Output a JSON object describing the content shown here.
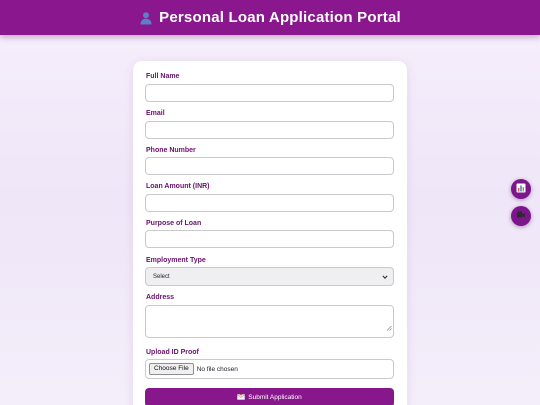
{
  "header": {
    "title": "Personal Loan Application Portal",
    "icon": "user-icon"
  },
  "form": {
    "full_name": {
      "label": "Full Name",
      "value": ""
    },
    "email": {
      "label": "Email",
      "value": ""
    },
    "phone": {
      "label": "Phone Number",
      "value": ""
    },
    "loan_amount": {
      "label": "Loan Amount (INR)",
      "value": ""
    },
    "purpose": {
      "label": "Purpose of Loan",
      "value": ""
    },
    "employment_type": {
      "label": "Employment Type",
      "selected": "Select"
    },
    "address": {
      "label": "Address",
      "value": ""
    },
    "id_proof": {
      "label": "Upload ID Proof",
      "button": "Choose File",
      "status": "No file chosen"
    },
    "submit": {
      "label": "Submit Application",
      "icon": "envelope-icon"
    }
  },
  "side_buttons": [
    {
      "icon": "bar-chart-icon"
    },
    {
      "icon": "video-camera-icon"
    }
  ],
  "colors": {
    "brand": "#8a178e",
    "label": "#6a106e",
    "background": "#f3ecf9"
  }
}
